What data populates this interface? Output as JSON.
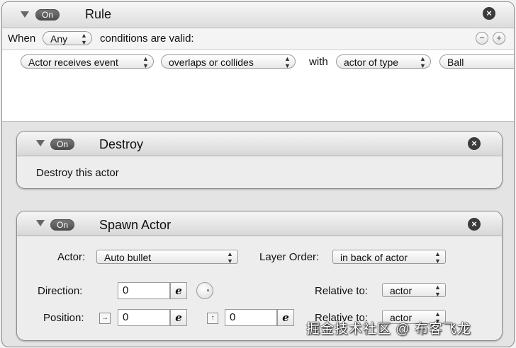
{
  "rule": {
    "toggle_label": "On",
    "title": "Rule",
    "when_label": "When",
    "match_select": "Any",
    "conditions_text": "conditions are valid:",
    "condition": {
      "subject": "Actor receives event",
      "event": "overlaps or collides",
      "with_label": "with",
      "target_kind": "actor of type",
      "target_value": "Ball"
    }
  },
  "behaviors": [
    {
      "toggle_label": "On",
      "title": "Destroy",
      "description": "Destroy this actor"
    },
    {
      "toggle_label": "On",
      "title": "Spawn Actor",
      "actor_label": "Actor:",
      "actor_value": "Auto bullet",
      "layer_order_label": "Layer Order:",
      "layer_order_value": "in back of actor",
      "direction_label": "Direction:",
      "direction_value": "0",
      "relative_label_1": "Relative to:",
      "relative_value_1": "actor",
      "position_label": "Position:",
      "position_x": "0",
      "position_y": "0",
      "relative_label_2": "Relative to:",
      "relative_value_2": "actor"
    }
  ],
  "icons": {
    "expression": "e",
    "close": "×",
    "minus": "−",
    "plus": "+"
  },
  "watermark": "掘金技术社区 @ 布客飞龙"
}
